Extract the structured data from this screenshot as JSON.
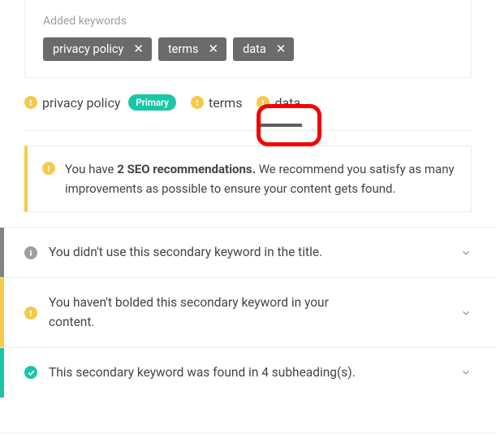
{
  "added": {
    "label": "Added keywords",
    "chips": [
      {
        "text": "privacy policy"
      },
      {
        "text": "terms"
      },
      {
        "text": "data"
      }
    ]
  },
  "keywords": [
    {
      "text": "privacy policy",
      "status": "warn",
      "primary_label": "Primary"
    },
    {
      "text": "terms",
      "status": "warn"
    },
    {
      "text": "data",
      "status": "warn",
      "active": true
    }
  ],
  "recommendation": {
    "prefix": "You have ",
    "bold": "2 SEO recommendations.",
    "rest": " We recommend you satisfy as many improvements as possible to ensure your content gets found."
  },
  "items": [
    {
      "status": "gray",
      "text": "You didn't use this secondary keyword in the title."
    },
    {
      "status": "warn",
      "text": "You haven't bolded this secondary keyword in your content."
    },
    {
      "status": "ok",
      "text": "This secondary keyword was found in 4 subheading(s)."
    }
  ]
}
